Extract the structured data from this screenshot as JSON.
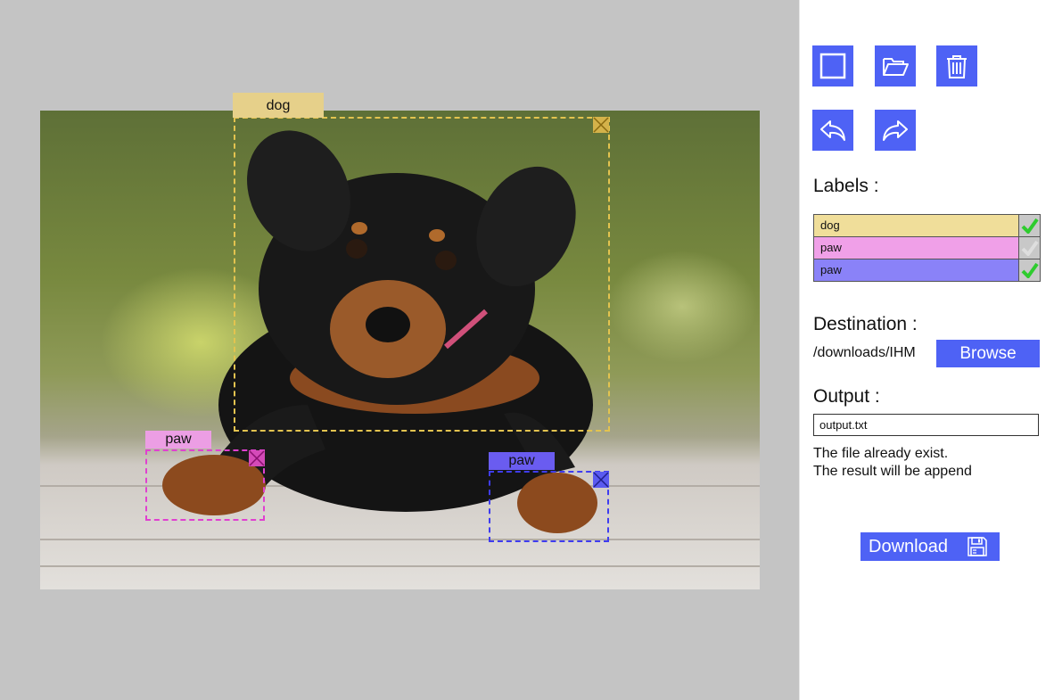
{
  "toolbar": {
    "buttons": [
      {
        "name": "rectangle-tool-button",
        "icon": "square-icon"
      },
      {
        "name": "open-folder-button",
        "icon": "folder-open-icon"
      },
      {
        "name": "delete-button",
        "icon": "trash-icon"
      },
      {
        "name": "undo-button",
        "icon": "undo-icon"
      },
      {
        "name": "redo-button",
        "icon": "redo-icon"
      }
    ]
  },
  "labels": {
    "title": "Labels :",
    "items": [
      {
        "label": "dog",
        "color": "#f0de9a",
        "checked": true
      },
      {
        "label": "paw",
        "color": "#f0a0e8",
        "checked": false
      },
      {
        "label": "paw",
        "color": "#8a82f8",
        "checked": true
      }
    ]
  },
  "destination": {
    "title": "Destination :",
    "path": "/downloads/IHM",
    "browse_label": "Browse"
  },
  "output": {
    "title": "Output :",
    "value": "output.txt",
    "message_line1": "The file already exist.",
    "message_line2": "The result will be append"
  },
  "download": {
    "label": "Download",
    "icon": "floppy-disk-icon"
  },
  "annotations": [
    {
      "label": "dog",
      "color": "#e3c34f",
      "tag_color": "#e6d08a"
    },
    {
      "label": "paw",
      "color": "#e040d0",
      "tag_color": "#ec9ee4"
    },
    {
      "label": "paw",
      "color": "#3f3cf0",
      "tag_color": "#6a5cf0"
    }
  ],
  "colors": {
    "accent": "#4e62f5",
    "check": "#2ecc2e"
  }
}
